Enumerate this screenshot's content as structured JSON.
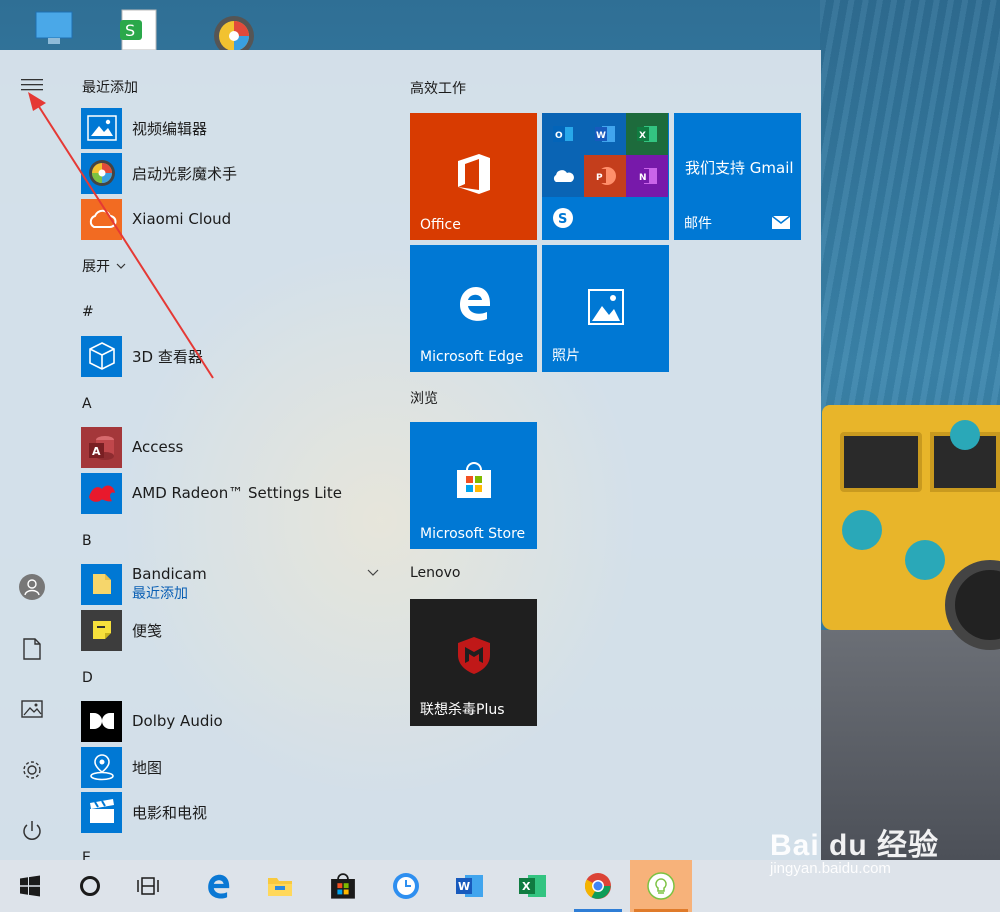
{
  "desktop": {
    "icons": [
      "this-pc-icon",
      "wps-spreadsheet-icon",
      "color-wheel-app-icon"
    ]
  },
  "start_menu": {
    "rail": {
      "items": [
        "hamburger-menu-icon",
        "user-avatar-icon",
        "documents-icon",
        "pictures-icon",
        "settings-icon",
        "power-icon"
      ]
    },
    "recent": {
      "title": "最近添加",
      "items": [
        {
          "label": "视频编辑器",
          "icon": "video-editor-icon",
          "color": "#0078d4"
        },
        {
          "label": "启动光影魔术手",
          "icon": "nevision-icon",
          "color": "#0078d4"
        },
        {
          "label": "Xiaomi Cloud",
          "icon": "xiaomi-cloud-icon",
          "color": "#f26b22"
        }
      ]
    },
    "expand_label": "展开",
    "sections": [
      {
        "letter": "#",
        "apps": [
          {
            "label": "3D 查看器",
            "icon": "3d-viewer-icon"
          }
        ]
      },
      {
        "letter": "A",
        "apps": [
          {
            "label": "Access",
            "icon": "access-icon"
          },
          {
            "label": "AMD Radeon™ Settings Lite",
            "icon": "amd-radeon-icon"
          }
        ]
      },
      {
        "letter": "B",
        "apps": [
          {
            "label": "Bandicam",
            "sub": "最近添加",
            "icon": "bandicam-folder-icon"
          },
          {
            "label": "便笺",
            "icon": "sticky-notes-icon"
          }
        ]
      },
      {
        "letter": "D",
        "apps": [
          {
            "label": "Dolby Audio",
            "icon": "dolby-icon"
          },
          {
            "label": "地图",
            "icon": "maps-icon"
          },
          {
            "label": "电影和电视",
            "icon": "movies-tv-icon"
          }
        ]
      },
      {
        "letter": "E",
        "apps": []
      }
    ],
    "tile_groups": [
      {
        "title": "高效工作"
      },
      {
        "title": "浏览"
      },
      {
        "title": "Lenovo"
      }
    ],
    "tiles": {
      "office": {
        "label": "Office",
        "color": "#d83b01"
      },
      "office_apps": {
        "color": "#0078d4",
        "icons": [
          "outlook-icon",
          "word-icon",
          "excel-icon",
          "onedrive-icon",
          "powerpoint-icon",
          "onenote-icon",
          "skype-icon"
        ]
      },
      "mail": {
        "label": "邮件",
        "headline": "我们支持 Gmail",
        "color": "#0078d4"
      },
      "edge": {
        "label": "Microsoft Edge",
        "color": "#0078d4"
      },
      "photos": {
        "label": "照片",
        "color": "#0078d4"
      },
      "store": {
        "label": "Microsoft Store",
        "color": "#0078d4"
      },
      "mcafee": {
        "label": "联想杀毒Plus",
        "color": "#1f1f1f"
      }
    }
  },
  "taskbar": {
    "items": [
      "windows-start-icon",
      "cortana-icon",
      "task-view-icon",
      "edge-icon",
      "file-explorer-icon",
      "store-icon",
      "clock-app-icon",
      "word-icon",
      "excel-icon",
      "chrome-icon",
      "lightbulb-app-icon"
    ]
  },
  "watermark": {
    "logo": "Bai du 经验",
    "url": "jingyan.baidu.com"
  }
}
